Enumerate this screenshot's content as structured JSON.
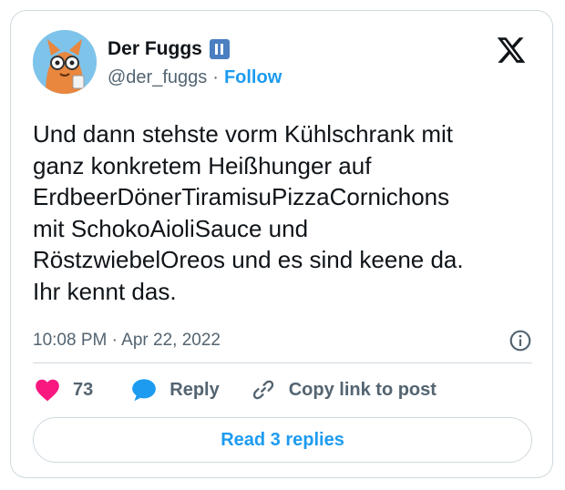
{
  "author": {
    "display_name": "Der Fuggs",
    "handle": "@der_fuggs",
    "separator": "·",
    "follow_label": "Follow"
  },
  "tweet": {
    "text": "Und dann stehste vorm Kühlschrank mit\nganz konkretem Heißhunger auf\nErdbeerDönerTiramisuPizzaCornichons\nmit SchokoAioliSauce und\nRöstzwiebelOreos und es sind keene da.\nIhr kennt das.",
    "timestamp": "10:08 PM · Apr 22, 2022"
  },
  "actions": {
    "like_count": "73",
    "reply_label": "Reply",
    "copy_label": "Copy link to post"
  },
  "read_replies_label": "Read 3 replies",
  "icons": {
    "verified": "badge-icon",
    "platform": "x-logo-icon",
    "info": "info-icon",
    "like": "heart-icon",
    "reply": "speech-bubble-icon",
    "copy": "link-icon"
  },
  "colors": {
    "accent": "#1d9bf0",
    "like": "#f91880",
    "muted": "#536471",
    "border": "#cfd9de",
    "badge": "#4a7fc1"
  }
}
